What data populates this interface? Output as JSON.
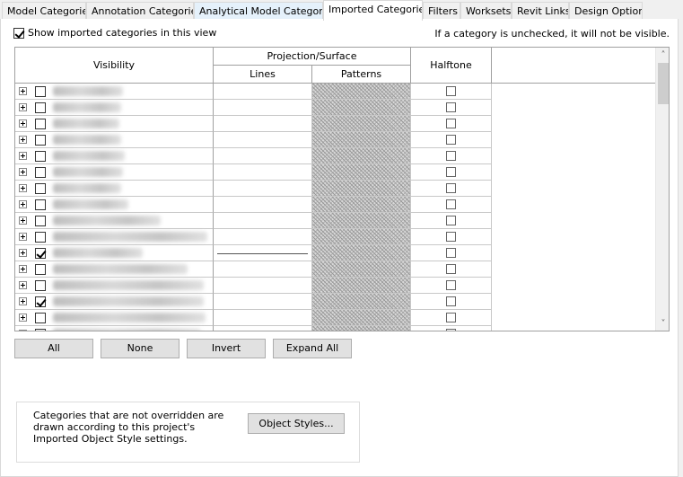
{
  "tabs": [
    {
      "label": "Model Categories"
    },
    {
      "label": "Annotation Categories"
    },
    {
      "label": "Analytical Model Categories"
    },
    {
      "label": "Imported Categories"
    },
    {
      "label": "Filters"
    },
    {
      "label": "Worksets"
    },
    {
      "label": "Revit Links"
    },
    {
      "label": "Design Options"
    }
  ],
  "active_tab": "Imported Categories",
  "show_imported": {
    "label": "Show imported categories in this view",
    "checked": true
  },
  "hint": "If a category is unchecked, it will not be visible.",
  "table": {
    "headers": {
      "visibility": "Visibility",
      "projection_surface": "Projection/Surface",
      "lines": "Lines",
      "patterns": "Patterns",
      "halftone": "Halftone"
    },
    "rows": [
      {
        "visible": false,
        "halftone": false,
        "line_override": false
      },
      {
        "visible": false,
        "halftone": false,
        "line_override": false
      },
      {
        "visible": false,
        "halftone": false,
        "line_override": false
      },
      {
        "visible": false,
        "halftone": false,
        "line_override": false
      },
      {
        "visible": false,
        "halftone": false,
        "line_override": false
      },
      {
        "visible": false,
        "halftone": false,
        "line_override": false
      },
      {
        "visible": false,
        "halftone": false,
        "line_override": false
      },
      {
        "visible": false,
        "halftone": false,
        "line_override": false
      },
      {
        "visible": false,
        "halftone": false,
        "line_override": false
      },
      {
        "visible": false,
        "halftone": false,
        "line_override": false
      },
      {
        "visible": true,
        "halftone": false,
        "line_override": true
      },
      {
        "visible": false,
        "halftone": false,
        "line_override": false
      },
      {
        "visible": false,
        "halftone": false,
        "line_override": false
      },
      {
        "visible": true,
        "halftone": false,
        "line_override": false
      },
      {
        "visible": false,
        "halftone": false,
        "line_override": false
      },
      {
        "visible": false,
        "halftone": false,
        "line_override": false
      }
    ]
  },
  "buttons": {
    "all": "All",
    "none": "None",
    "invert": "Invert",
    "expand_all": "Expand All"
  },
  "info": {
    "text": "Categories that are not overridden are drawn according to this project's Imported Object Style settings.",
    "object_styles_button": "Object Styles..."
  }
}
